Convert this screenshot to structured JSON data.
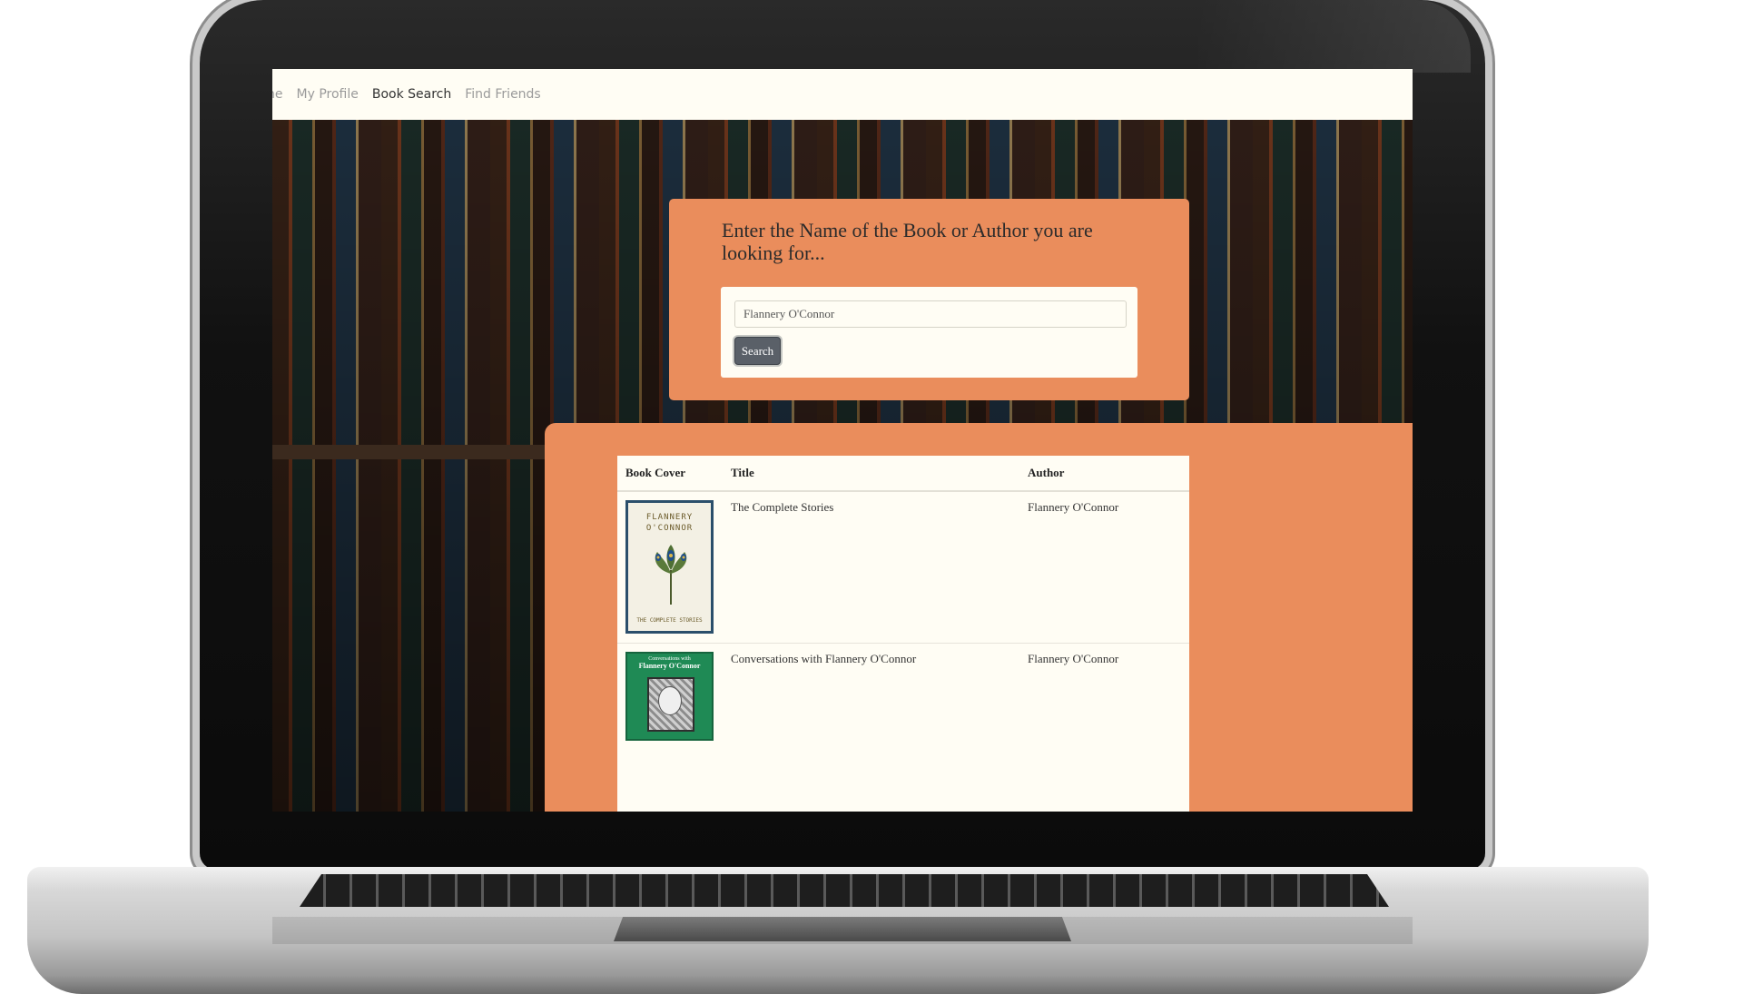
{
  "nav": {
    "items": [
      {
        "label": "ne",
        "active": false
      },
      {
        "label": "My Profile",
        "active": false
      },
      {
        "label": "Book Search",
        "active": true
      },
      {
        "label": "Find Friends",
        "active": false
      }
    ]
  },
  "search": {
    "heading": "Enter the Name of the Book or Author you are looking for...",
    "input_value": "Flannery O'Connor",
    "button_label": "Search"
  },
  "results": {
    "columns": [
      "Book Cover",
      "Title",
      "Author"
    ],
    "rows": [
      {
        "title": "The Complete Stories",
        "author": "Flannery O'Connor",
        "cover_text_top": "FLANNERY O'CONNOR",
        "cover_text_bottom": "THE COMPLETE STORIES"
      },
      {
        "title": "Conversations with Flannery O'Connor",
        "author": "Flannery O'Connor",
        "cover_text_top": "Conversations with",
        "cover_text_bottom": "Flannery O'Connor"
      }
    ]
  },
  "colors": {
    "accent": "#ea8d5c",
    "page_bg": "#fffdf4",
    "button": "#5a6068"
  }
}
